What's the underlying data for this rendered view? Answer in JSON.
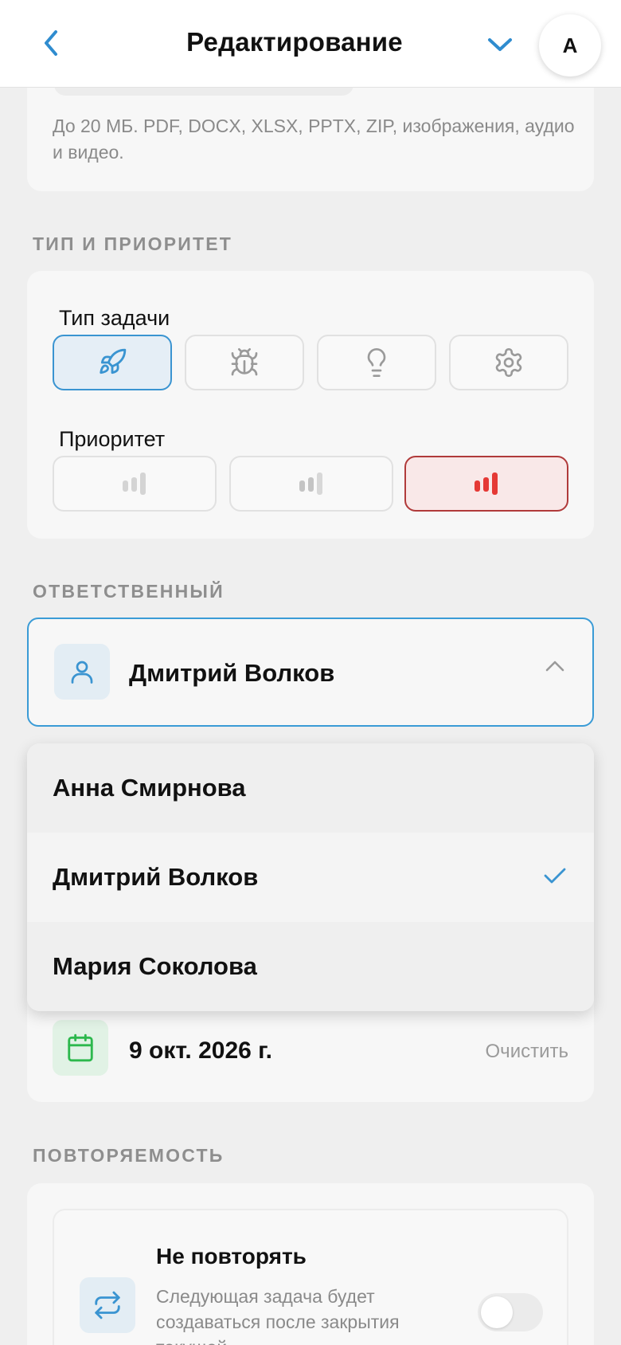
{
  "header": {
    "title": "Редактирование",
    "avatar_initial": "А"
  },
  "attachments": {
    "hint": "До 20 МБ. PDF, DOCX, XLSX, PPTX, ZIP, изображения, аудио и видео."
  },
  "type_priority": {
    "section_label": "ТИП И ПРИОРИТЕТ",
    "task_type_label": "Тип задачи",
    "task_types": [
      {
        "icon": "rocket-icon",
        "selected": true
      },
      {
        "icon": "bug-icon",
        "selected": false
      },
      {
        "icon": "lightbulb-icon",
        "selected": false
      },
      {
        "icon": "gear-icon",
        "selected": false
      }
    ],
    "priority_label": "Приоритет",
    "priorities": [
      {
        "icon": "priority-low-icon",
        "selected": false
      },
      {
        "icon": "priority-medium-icon",
        "selected": false
      },
      {
        "icon": "priority-high-icon",
        "selected": true
      }
    ]
  },
  "assignee": {
    "section_label": "ОТВЕТСТВЕННЫЙ",
    "selected": "Дмитрий Волков",
    "options": [
      {
        "label": "Анна Смирнова",
        "selected": false
      },
      {
        "label": "Дмитрий Волков",
        "selected": true
      },
      {
        "label": "Мария Соколова",
        "selected": false
      }
    ]
  },
  "due_date": {
    "value": "9 окт. 2026 г.",
    "clear_label": "Очистить"
  },
  "recurrence": {
    "section_label": "ПОВТОРЯЕМОСТЬ",
    "title": "Не повторять",
    "description": "Следующая задача будет создаваться после закрытия текущей.",
    "enabled": false
  },
  "colors": {
    "accent": "#3a94d1",
    "priority_high": "#e53935",
    "calendar_green": "#2db84d"
  }
}
